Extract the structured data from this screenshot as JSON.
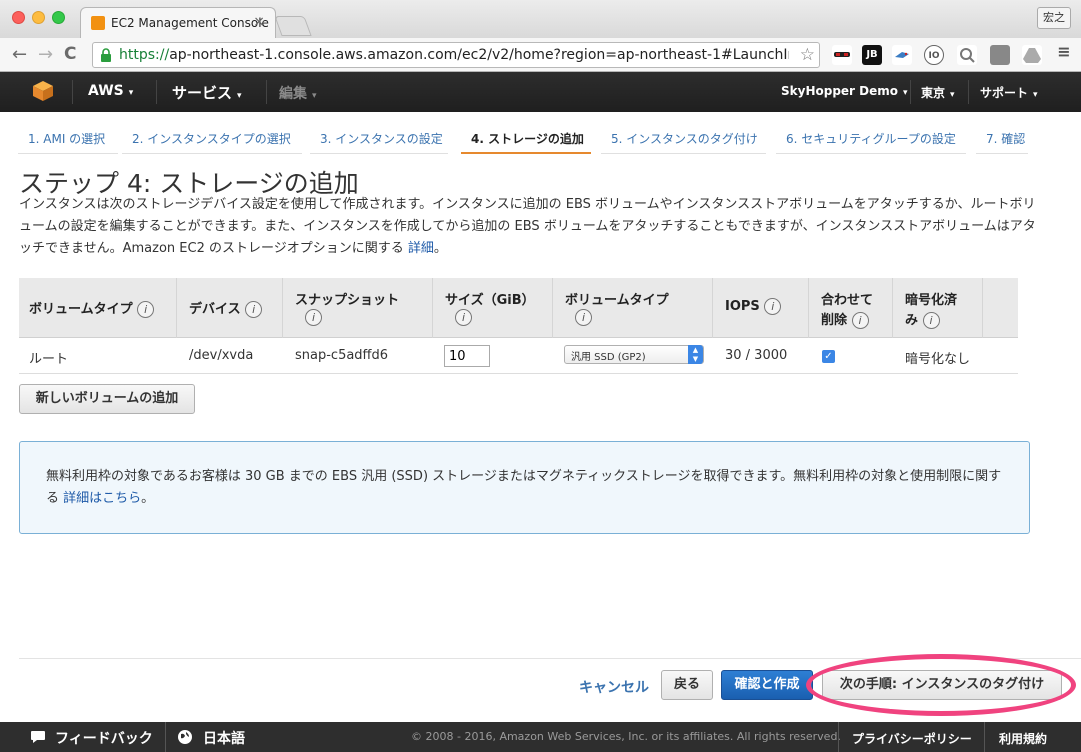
{
  "browser": {
    "tab_title": "EC2 Management Console",
    "tab_close": "×",
    "profile": "宏之",
    "url_https": "https://",
    "url_rest": "ap-northeast-1.console.aws.amazon.com/ec2/v2/home?region=ap-northeast-1#LaunchInsta...",
    "back": "←",
    "forward": "→",
    "reload": "C",
    "bookmark_star": "☆",
    "extensions": [
      "JB",
      "IO"
    ]
  },
  "nav": {
    "aws": "AWS",
    "services": "サービス",
    "edit": "編集",
    "account": "SkyHopper Demo",
    "region": "東京",
    "support": "サポート",
    "caret": "▾"
  },
  "steps": [
    {
      "label": "1. AMI の選択"
    },
    {
      "label": "2. インスタンスタイプの選択"
    },
    {
      "label": "3. インスタンスの設定"
    },
    {
      "label": "4. ストレージの追加"
    },
    {
      "label": "5. インスタンスのタグ付け"
    },
    {
      "label": "6. セキュリティグループの設定"
    },
    {
      "label": "7. 確認"
    }
  ],
  "page": {
    "title": "ステップ 4: ストレージの追加",
    "description": "インスタンスは次のストレージデバイス設定を使用して作成されます。インスタンスに追加の EBS ボリュームやインスタンスストアボリュームをアタッチするか、ルートボリュームの設定を編集することができます。また、インスタンスを作成してから追加の EBS ボリュームをアタッチすることもできますが、インスタンスストアボリュームはアタッチできません。Amazon EC2 のストレージオプションに関する",
    "description_link": "詳細",
    "description_end": "。"
  },
  "table": {
    "info_icon": "i",
    "headers": [
      {
        "line1": "ボリュームタイプ",
        "line2": ""
      },
      {
        "line1": "デバイス",
        "line2": ""
      },
      {
        "line1": "スナップショット",
        "line2": ""
      },
      {
        "line1": "サイズ（GiB）",
        "line2": ""
      },
      {
        "line1": "ボリュームタイプ",
        "line2": ""
      },
      {
        "line1": "IOPS",
        "line2": ""
      },
      {
        "line1": "合わせて",
        "line2": "削除"
      },
      {
        "line1": "暗号化済",
        "line2": "み"
      }
    ],
    "row": {
      "type": "ルート",
      "device": "/dev/xvda",
      "snapshot": "snap-c5adffd6",
      "size": "10",
      "volume_type": "汎用 SSD (GP2)",
      "iops": "30 / 3000",
      "delete_on_termination": "✓",
      "encrypted": "暗号化なし"
    }
  },
  "buttons": {
    "add_volume": "新しいボリュームの追加",
    "cancel": "キャンセル",
    "back": "戻る",
    "review_launch": "確認と作成",
    "next": "次の手順: インスタンスのタグ付け"
  },
  "notice": {
    "text": "無料利用枠の対象であるお客様は 30 GB までの EBS 汎用 (SSD) ストレージまたはマグネティックストレージを取得できます。無料利用枠の対象と使用制限に関する",
    "link": "詳細はこちら",
    "end": "。"
  },
  "footer": {
    "feedback": "フィードバック",
    "language": "日本語",
    "copyright": "© 2008 - 2016, Amazon Web Services, Inc. or its affiliates. All rights reserved.",
    "privacy": "プライバシーポリシー",
    "terms": "利用規約"
  },
  "colors": {
    "accent_orange": "#e6892e",
    "link_blue": "#3b73af",
    "primary_button": "#1a5fb0",
    "highlight_ring": "#f0437f"
  }
}
